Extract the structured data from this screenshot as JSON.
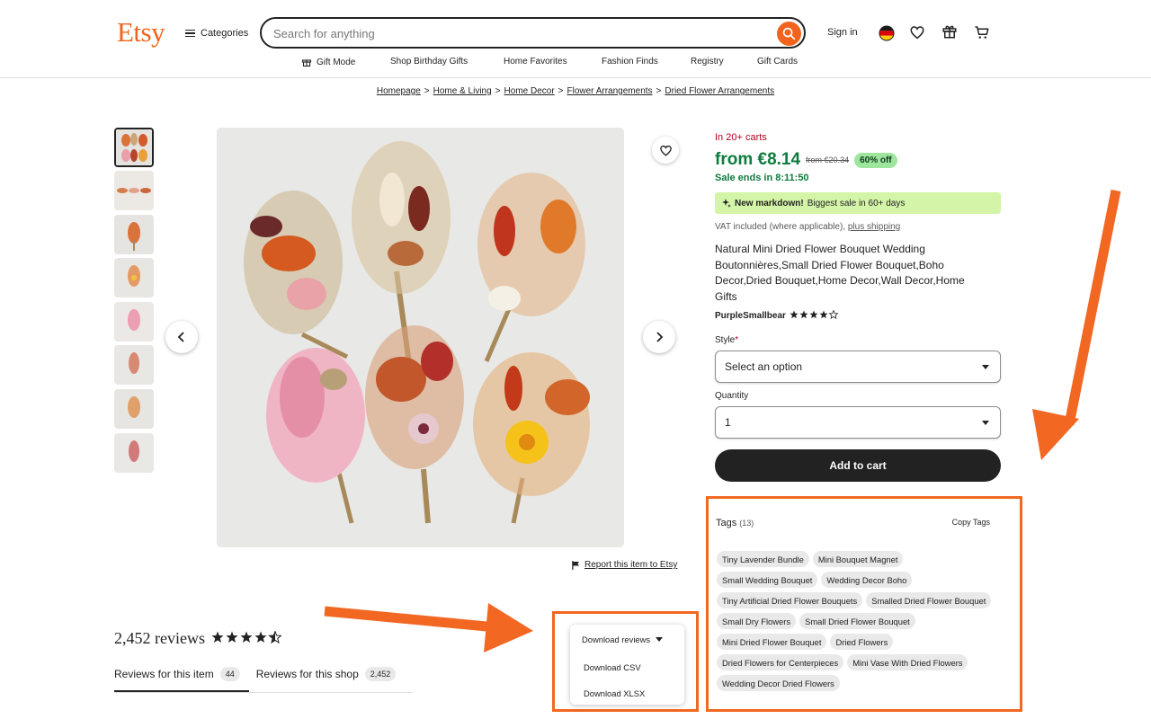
{
  "header": {
    "logo": "Etsy",
    "categories_label": "Categories",
    "search_placeholder": "Search for anything",
    "sign_in": "Sign in",
    "icons": [
      "search-icon",
      "germany-flag-icon",
      "heart-icon",
      "gift-icon",
      "cart-icon"
    ]
  },
  "subnav": {
    "gift_mode": "Gift Mode",
    "items": [
      "Shop Birthday Gifts",
      "Home Favorites",
      "Fashion Finds",
      "Registry",
      "Gift Cards"
    ]
  },
  "breadcrumb": [
    "Homepage",
    "Home & Living",
    "Home Decor",
    "Flower Arrangements",
    "Dried Flower Arrangements"
  ],
  "gallery": {
    "thumbnail_count": 8,
    "selected_index": 0,
    "report_link": "Report this item to Etsy"
  },
  "listing": {
    "in_carts": "In 20+ carts",
    "price": "from €8.14",
    "original_price": "from €20.34",
    "discount": "60% off",
    "sale_ends": "Sale ends in 8:11:50",
    "markdown_bold": "New markdown!",
    "markdown_text": "Biggest sale in 60+ days",
    "vat_text": "VAT included (where applicable),",
    "vat_link": "plus shipping",
    "title": "Natural Mini Dried Flower Bouquet Wedding Boutonnières,Small Dried Flower Bouquet,Boho Decor,Dried Bouquet,Home Decor,Wall Decor,Home Gifts",
    "shop_name": "PurpleSmallbear",
    "shop_rating": 4.5,
    "style_label": "Style",
    "style_required": "*",
    "style_value": "Select an option",
    "quantity_label": "Quantity",
    "quantity_value": "1",
    "add_to_cart": "Add to cart"
  },
  "tags": {
    "title": "Tags",
    "count": "(13)",
    "copy_label": "Copy Tags",
    "items": [
      "Tiny Lavender Bundle",
      "Mini Bouquet Magnet",
      "Small Wedding Bouquet",
      "Wedding Decor Boho",
      "Tiny Artificial Dried Flower Bouquets",
      "Smalled Dried Flower Bouquet",
      "Small Dry Flowers",
      "Small Dried Flower Bouquet",
      "Mini Dried Flower Bouquet",
      "Dried Flowers",
      "Dried Flowers for Centerpieces",
      "Mini Vase With Dried Flowers",
      "Wedding Decor Dried Flowers"
    ]
  },
  "reviews": {
    "count_text": "2,452 reviews",
    "rating": 4.5,
    "tab_item_label": "Reviews for this item",
    "tab_item_count": "44",
    "tab_shop_label": "Reviews for this shop",
    "tab_shop_count": "2,452",
    "selected_tab": "Reviews for this item"
  },
  "download_menu": {
    "label": "Download reviews",
    "items": [
      "Download CSV",
      "Download XLSX"
    ]
  },
  "colors": {
    "brand": "#f1641e",
    "price_green": "#0f7b3e",
    "in_carts_red": "#b3001e",
    "highlight_orange": "#f26722",
    "markdown_bg": "#d4f5a8"
  }
}
